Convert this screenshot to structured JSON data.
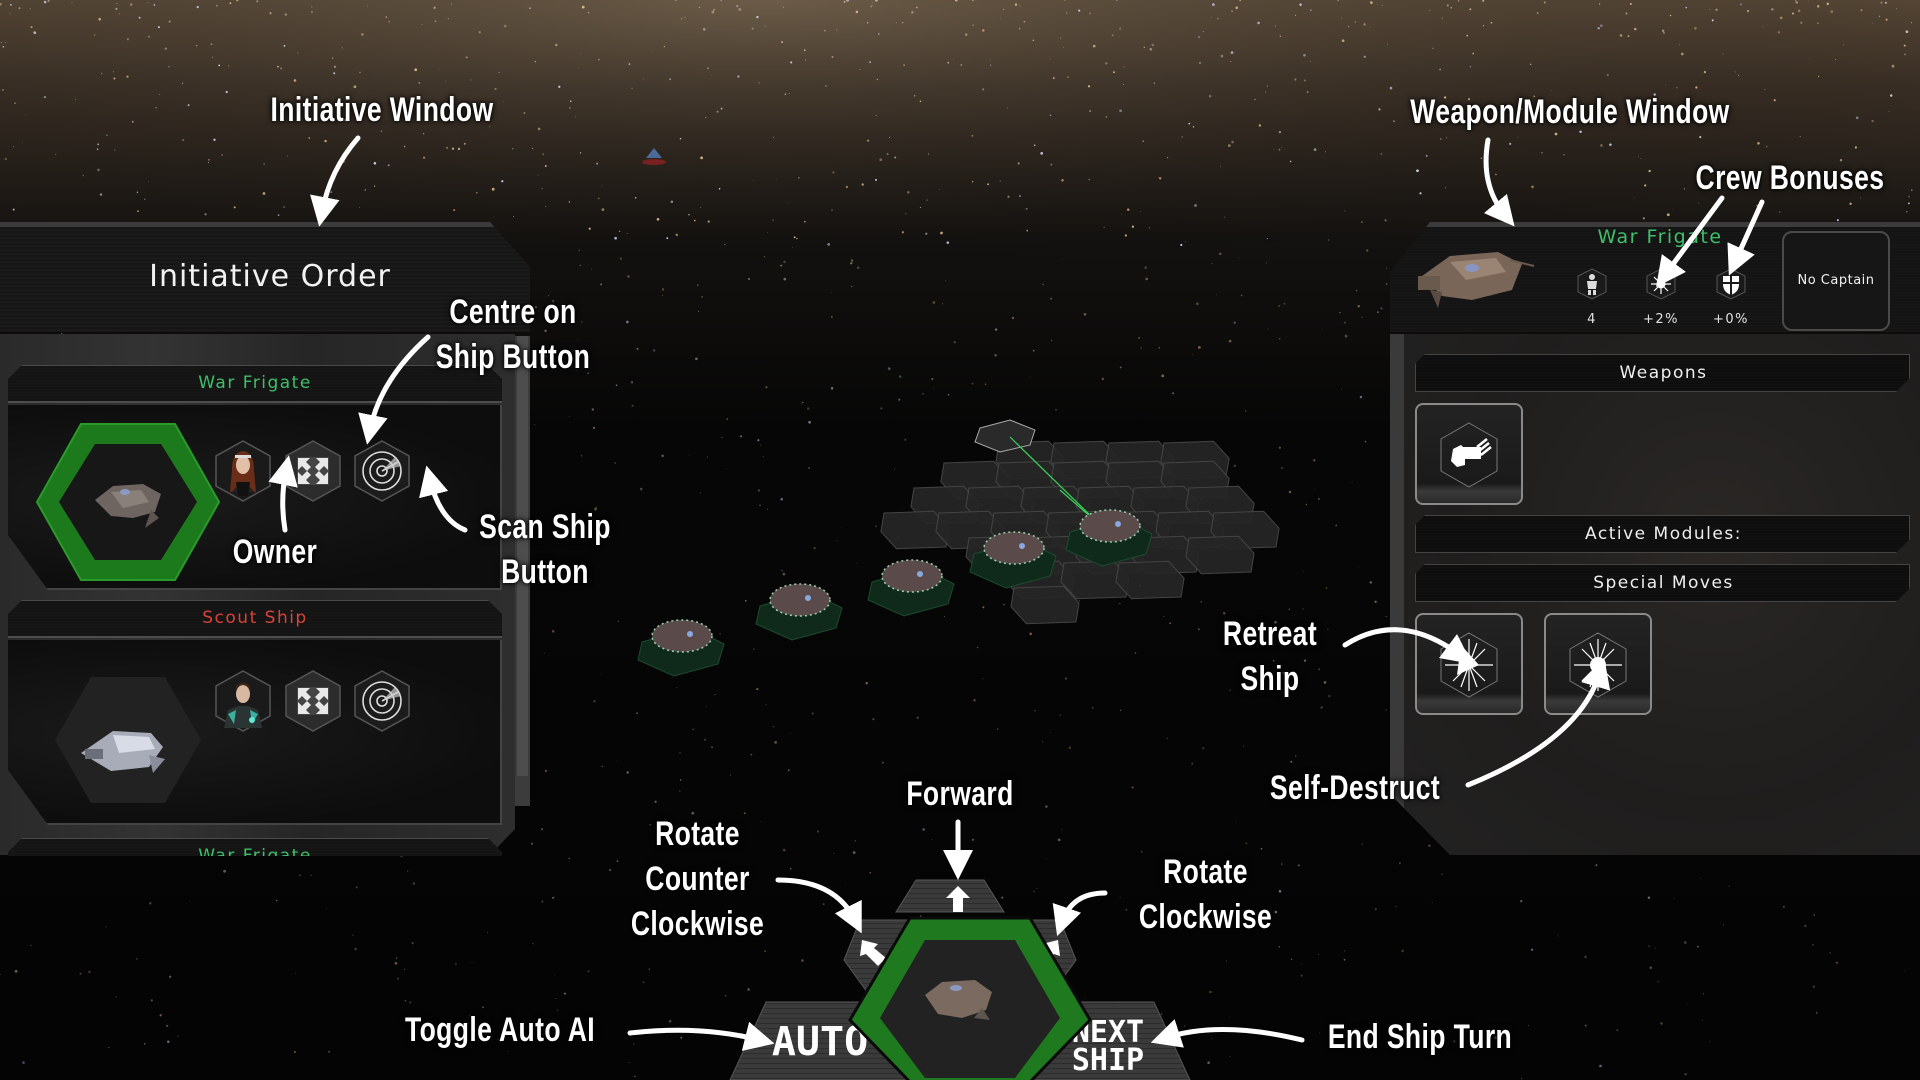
{
  "annotations": {
    "initiative_window": "Initiative Window",
    "weapon_module_window": "Weapon/Module Window",
    "crew_bonuses": "Crew Bonuses",
    "centre_on_ship": [
      "Centre on",
      "Ship Button"
    ],
    "owner": "Owner",
    "scan_ship": [
      "Scan Ship",
      "Button"
    ],
    "retreat_ship": [
      "Retreat",
      "Ship"
    ],
    "self_destruct": "Self-Destruct",
    "forward": "Forward",
    "rotate_ccw": [
      "Rotate",
      "Counter",
      "Clockwise"
    ],
    "rotate_cw": [
      "Rotate",
      "Clockwise"
    ],
    "toggle_auto_ai": "Toggle Auto AI",
    "end_ship_turn": "End Ship Turn"
  },
  "initiative": {
    "title": "Initiative Order",
    "ships": [
      {
        "name": "War Frigate",
        "color": "#3fbf6a",
        "selected": true,
        "owner_icon": "female-captain-portrait",
        "centre_icon": "expand-arrows-icon",
        "scan_icon": "radar-icon"
      },
      {
        "name": "Scout Ship",
        "color": "#d9443a",
        "selected": false,
        "owner_icon": "male-captain-portrait",
        "centre_icon": "expand-arrows-icon",
        "scan_icon": "radar-icon"
      },
      {
        "name": "War Frigate",
        "color": "#3fbf6a",
        "selected": false
      }
    ]
  },
  "weapon_window": {
    "ship_name": "War Frigate",
    "ship_name_color": "#3fbf6a",
    "crew": [
      {
        "icon": "crew-count-icon",
        "value": "4"
      },
      {
        "icon": "accuracy-bonus-icon",
        "value": "+2%"
      },
      {
        "icon": "defense-bonus-icon",
        "value": "+0%"
      }
    ],
    "captain": "No Captain",
    "sections": {
      "weapons": "Weapons",
      "active_modules": "Active Modules:",
      "special_moves": "Special Moves"
    },
    "weapons": [
      {
        "icon": "gatling-gun-icon"
      }
    ],
    "special_moves": [
      {
        "icon": "retreat-icon"
      },
      {
        "icon": "self-destruct-icon"
      }
    ]
  },
  "controls": {
    "auto_label": "AUTO",
    "next_label": [
      "NEXT",
      "SHIP"
    ],
    "accent": "#1f7a1f"
  }
}
